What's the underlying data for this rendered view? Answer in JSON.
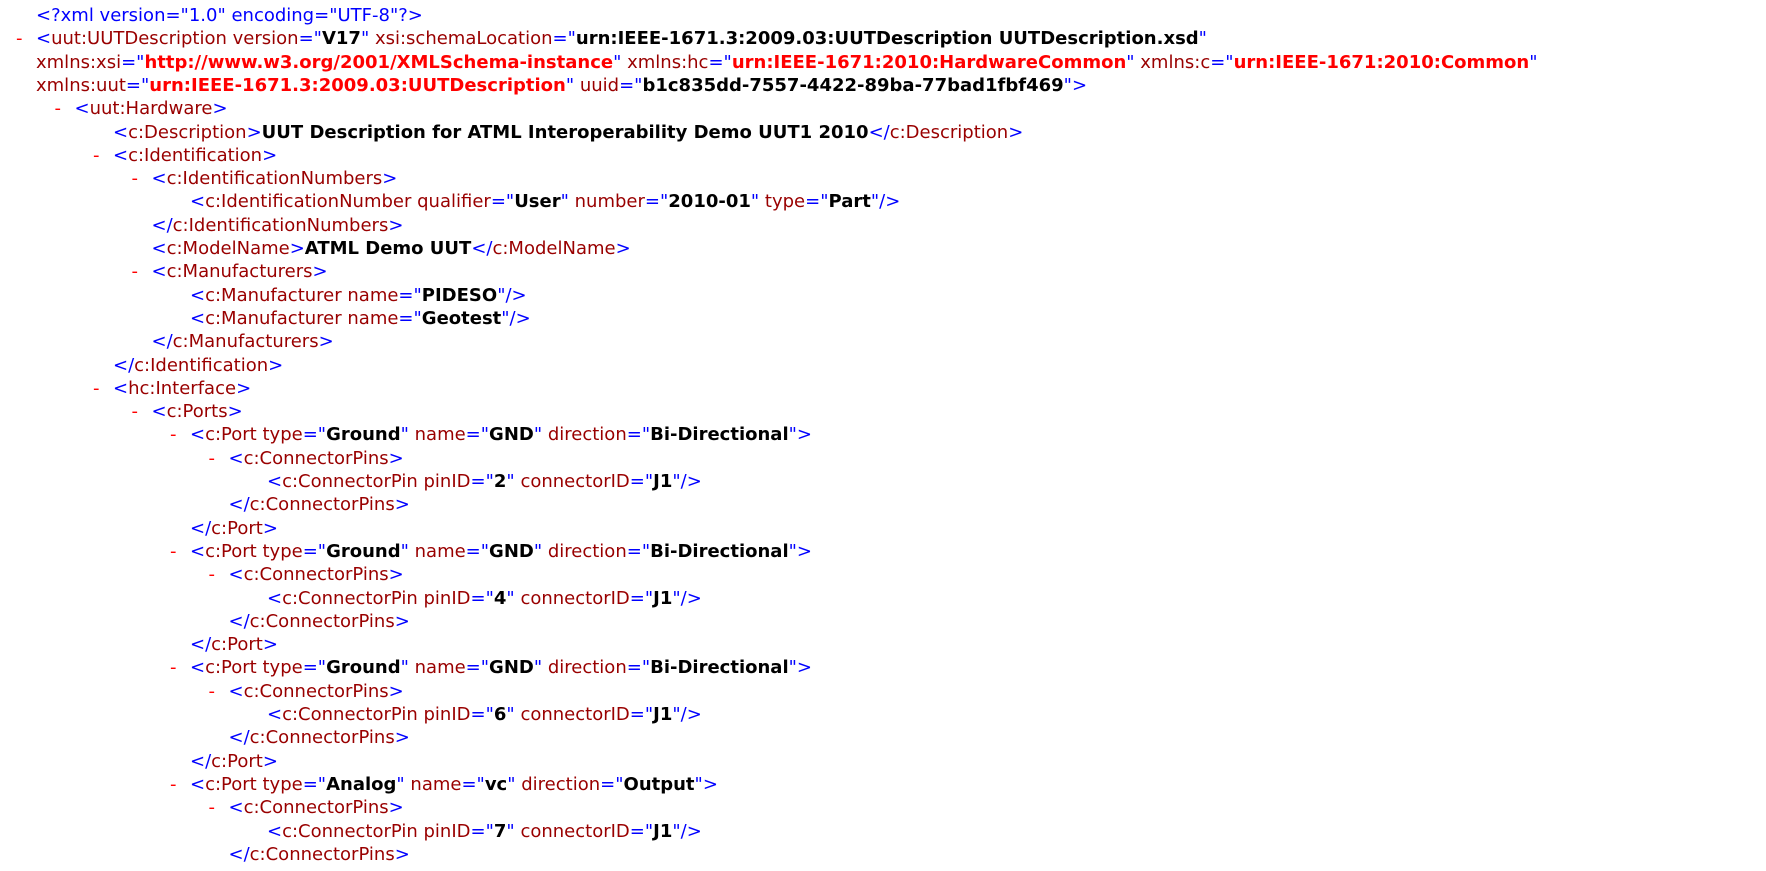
{
  "lines": [
    {
      "i": 0,
      "html": "<span class='tg'>&lt;?xml version=&quot;1.0&quot; encoding=&quot;UTF-8&quot;?&gt;</span>"
    },
    {
      "i": 0,
      "toggle": "-",
      "html": "<span class='tg'>&lt;</span><span class='nm'>uut:UUTDescription</span> <span class='at'>version</span><span class='tg'>=&quot;</span><span class='v'>V17</span><span class='tg'>&quot;</span> <span class='at'>xsi:schemaLocation</span><span class='tg'>=&quot;</span><span class='v'>urn:IEEE-1671.3:2009.03:UUTDescription UUTDescription.xsd</span><span class='tg'>&quot;</span>"
    },
    {
      "i": 0,
      "html": "<span class='at'>xmlns:xsi</span><span class='tg'>=&quot;</span><span class='vr'>http://www.w3.org/2001/XMLSchema-instance</span><span class='tg'>&quot;</span> <span class='at'>xmlns:hc</span><span class='tg'>=&quot;</span><span class='vr'>urn:IEEE-1671:2010:HardwareCommon</span><span class='tg'>&quot;</span> <span class='at'>xmlns:c</span><span class='tg'>=&quot;</span><span class='vr'>urn:IEEE-1671:2010:Common</span><span class='tg'>&quot;</span>"
    },
    {
      "i": 0,
      "html": "<span class='at'>xmlns:uut</span><span class='tg'>=&quot;</span><span class='vr'>urn:IEEE-1671.3:2009.03:UUTDescription</span><span class='tg'>&quot;</span> <span class='at'>uuid</span><span class='tg'>=&quot;</span><span class='v'>b1c835dd-7557-4422-89ba-77bad1fbf469</span><span class='tg'>&quot;&gt;</span>"
    },
    {
      "i": 1,
      "toggle": "-",
      "html": "<span class='tg'>&lt;</span><span class='nm'>uut:Hardware</span><span class='tg'>&gt;</span>"
    },
    {
      "i": 2,
      "html": "<span class='tg'>&lt;</span><span class='nm'>c:Description</span><span class='tg'>&gt;</span><span class='tx'>UUT Description for ATML Interoperability Demo UUT1 2010</span><span class='tg'>&lt;/</span><span class='nm'>c:Description</span><span class='tg'>&gt;</span>"
    },
    {
      "i": 2,
      "toggle": "-",
      "html": "<span class='tg'>&lt;</span><span class='nm'>c:Identification</span><span class='tg'>&gt;</span>"
    },
    {
      "i": 3,
      "toggle": "-",
      "html": "<span class='tg'>&lt;</span><span class='nm'>c:IdentificationNumbers</span><span class='tg'>&gt;</span>"
    },
    {
      "i": 4,
      "html": "<span class='tg'>&lt;</span><span class='nm'>c:IdentificationNumber</span> <span class='at'>qualifier</span><span class='tg'>=&quot;</span><span class='v'>User</span><span class='tg'>&quot;</span> <span class='at'>number</span><span class='tg'>=&quot;</span><span class='v'>2010-01</span><span class='tg'>&quot;</span> <span class='at'>type</span><span class='tg'>=&quot;</span><span class='v'>Part</span><span class='tg'>&quot;/&gt;</span>"
    },
    {
      "i": 3,
      "html": "<span class='tg'>&lt;/</span><span class='nm'>c:IdentificationNumbers</span><span class='tg'>&gt;</span>"
    },
    {
      "i": 3,
      "html": "<span class='tg'>&lt;</span><span class='nm'>c:ModelName</span><span class='tg'>&gt;</span><span class='tx'>ATML Demo UUT</span><span class='tg'>&lt;/</span><span class='nm'>c:ModelName</span><span class='tg'>&gt;</span>"
    },
    {
      "i": 3,
      "toggle": "-",
      "html": "<span class='tg'>&lt;</span><span class='nm'>c:Manufacturers</span><span class='tg'>&gt;</span>"
    },
    {
      "i": 4,
      "html": "<span class='tg'>&lt;</span><span class='nm'>c:Manufacturer</span> <span class='at'>name</span><span class='tg'>=&quot;</span><span class='v'>PIDESO</span><span class='tg'>&quot;/&gt;</span>"
    },
    {
      "i": 4,
      "html": "<span class='tg'>&lt;</span><span class='nm'>c:Manufacturer</span> <span class='at'>name</span><span class='tg'>=&quot;</span><span class='v'>Geotest</span><span class='tg'>&quot;/&gt;</span>"
    },
    {
      "i": 3,
      "html": "<span class='tg'>&lt;/</span><span class='nm'>c:Manufacturers</span><span class='tg'>&gt;</span>"
    },
    {
      "i": 2,
      "html": "<span class='tg'>&lt;/</span><span class='nm'>c:Identification</span><span class='tg'>&gt;</span>"
    },
    {
      "i": 2,
      "toggle": "-",
      "html": "<span class='tg'>&lt;</span><span class='nm'>hc:Interface</span><span class='tg'>&gt;</span>"
    },
    {
      "i": 3,
      "toggle": "-",
      "html": "<span class='tg'>&lt;</span><span class='nm'>c:Ports</span><span class='tg'>&gt;</span>"
    },
    {
      "i": 4,
      "toggle": "-",
      "html": "<span class='tg'>&lt;</span><span class='nm'>c:Port</span> <span class='at'>type</span><span class='tg'>=&quot;</span><span class='v'>Ground</span><span class='tg'>&quot;</span> <span class='at'>name</span><span class='tg'>=&quot;</span><span class='v'>GND</span><span class='tg'>&quot;</span> <span class='at'>direction</span><span class='tg'>=&quot;</span><span class='v'>Bi-Directional</span><span class='tg'>&quot;&gt;</span>"
    },
    {
      "i": 5,
      "toggle": "-",
      "html": "<span class='tg'>&lt;</span><span class='nm'>c:ConnectorPins</span><span class='tg'>&gt;</span>"
    },
    {
      "i": 6,
      "html": "<span class='tg'>&lt;</span><span class='nm'>c:ConnectorPin</span> <span class='at'>pinID</span><span class='tg'>=&quot;</span><span class='v'>2</span><span class='tg'>&quot;</span> <span class='at'>connectorID</span><span class='tg'>=&quot;</span><span class='v'>J1</span><span class='tg'>&quot;/&gt;</span>"
    },
    {
      "i": 5,
      "html": "<span class='tg'>&lt;/</span><span class='nm'>c:ConnectorPins</span><span class='tg'>&gt;</span>"
    },
    {
      "i": 4,
      "html": "<span class='tg'>&lt;/</span><span class='nm'>c:Port</span><span class='tg'>&gt;</span>"
    },
    {
      "i": 4,
      "toggle": "-",
      "html": "<span class='tg'>&lt;</span><span class='nm'>c:Port</span> <span class='at'>type</span><span class='tg'>=&quot;</span><span class='v'>Ground</span><span class='tg'>&quot;</span> <span class='at'>name</span><span class='tg'>=&quot;</span><span class='v'>GND</span><span class='tg'>&quot;</span> <span class='at'>direction</span><span class='tg'>=&quot;</span><span class='v'>Bi-Directional</span><span class='tg'>&quot;&gt;</span>"
    },
    {
      "i": 5,
      "toggle": "-",
      "html": "<span class='tg'>&lt;</span><span class='nm'>c:ConnectorPins</span><span class='tg'>&gt;</span>"
    },
    {
      "i": 6,
      "html": "<span class='tg'>&lt;</span><span class='nm'>c:ConnectorPin</span> <span class='at'>pinID</span><span class='tg'>=&quot;</span><span class='v'>4</span><span class='tg'>&quot;</span> <span class='at'>connectorID</span><span class='tg'>=&quot;</span><span class='v'>J1</span><span class='tg'>&quot;/&gt;</span>"
    },
    {
      "i": 5,
      "html": "<span class='tg'>&lt;/</span><span class='nm'>c:ConnectorPins</span><span class='tg'>&gt;</span>"
    },
    {
      "i": 4,
      "html": "<span class='tg'>&lt;/</span><span class='nm'>c:Port</span><span class='tg'>&gt;</span>"
    },
    {
      "i": 4,
      "toggle": "-",
      "html": "<span class='tg'>&lt;</span><span class='nm'>c:Port</span> <span class='at'>type</span><span class='tg'>=&quot;</span><span class='v'>Ground</span><span class='tg'>&quot;</span> <span class='at'>name</span><span class='tg'>=&quot;</span><span class='v'>GND</span><span class='tg'>&quot;</span> <span class='at'>direction</span><span class='tg'>=&quot;</span><span class='v'>Bi-Directional</span><span class='tg'>&quot;&gt;</span>"
    },
    {
      "i": 5,
      "toggle": "-",
      "html": "<span class='tg'>&lt;</span><span class='nm'>c:ConnectorPins</span><span class='tg'>&gt;</span>"
    },
    {
      "i": 6,
      "html": "<span class='tg'>&lt;</span><span class='nm'>c:ConnectorPin</span> <span class='at'>pinID</span><span class='tg'>=&quot;</span><span class='v'>6</span><span class='tg'>&quot;</span> <span class='at'>connectorID</span><span class='tg'>=&quot;</span><span class='v'>J1</span><span class='tg'>&quot;/&gt;</span>"
    },
    {
      "i": 5,
      "html": "<span class='tg'>&lt;/</span><span class='nm'>c:ConnectorPins</span><span class='tg'>&gt;</span>"
    },
    {
      "i": 4,
      "html": "<span class='tg'>&lt;/</span><span class='nm'>c:Port</span><span class='tg'>&gt;</span>"
    },
    {
      "i": 4,
      "toggle": "-",
      "html": "<span class='tg'>&lt;</span><span class='nm'>c:Port</span> <span class='at'>type</span><span class='tg'>=&quot;</span><span class='v'>Analog</span><span class='tg'>&quot;</span> <span class='at'>name</span><span class='tg'>=&quot;</span><span class='v'>vc</span><span class='tg'>&quot;</span> <span class='at'>direction</span><span class='tg'>=&quot;</span><span class='v'>Output</span><span class='tg'>&quot;&gt;</span>"
    },
    {
      "i": 5,
      "toggle": "-",
      "html": "<span class='tg'>&lt;</span><span class='nm'>c:ConnectorPins</span><span class='tg'>&gt;</span>"
    },
    {
      "i": 6,
      "html": "<span class='tg'>&lt;</span><span class='nm'>c:ConnectorPin</span> <span class='at'>pinID</span><span class='tg'>=&quot;</span><span class='v'>7</span><span class='tg'>&quot;</span> <span class='at'>connectorID</span><span class='tg'>=&quot;</span><span class='v'>J1</span><span class='tg'>&quot;/&gt;</span>"
    },
    {
      "i": 5,
      "html": "<span class='tg'>&lt;/</span><span class='nm'>c:ConnectorPins</span><span class='tg'>&gt;</span>"
    }
  ]
}
